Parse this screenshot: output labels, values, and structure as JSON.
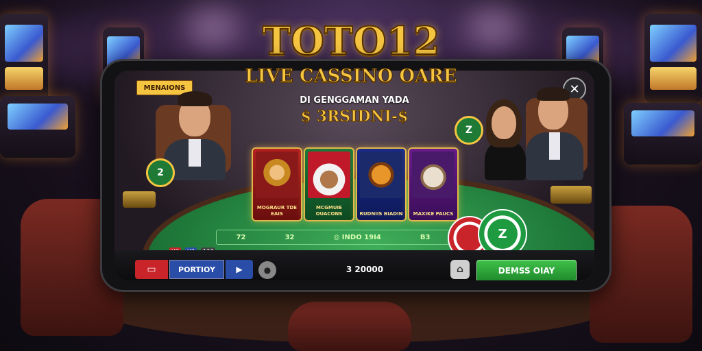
{
  "app": {
    "title": "TOTO12",
    "subtitle": "LIVE CASSINO OARE",
    "tagline": "DI GENGGAMAN YADA",
    "banner": "$ 3RSIDNI-$"
  },
  "table_badge": "MENAIONS",
  "close_icon": "close-icon",
  "games": [
    {
      "label": "MOGRAUR TDE EAIS",
      "art": "woman-hat"
    },
    {
      "label": "MCGMUIE OUACONS",
      "art": "dog-cards"
    },
    {
      "label": "RUDNIIS BIADIN",
      "art": "tiger"
    },
    {
      "label": "MAXIKE PAUCS",
      "art": "lioness"
    }
  ],
  "bet_row": [
    "72",
    "32",
    "INDO 19I4",
    "B3"
  ],
  "bet_icon": "coin-icon",
  "mini_status": [
    "U3",
    "U3",
    "134"
  ],
  "chips": {
    "left": "2",
    "right": "Z"
  },
  "controls": {
    "input_value": "PORTIOY",
    "amount": "3 20000",
    "action": "DEMSS OIAY"
  },
  "colors": {
    "gold": "#f5c542",
    "felt": "#1f7a3a",
    "action_green": "#2fa83a",
    "input_blue": "#2a4ea8",
    "red": "#c8242a"
  }
}
